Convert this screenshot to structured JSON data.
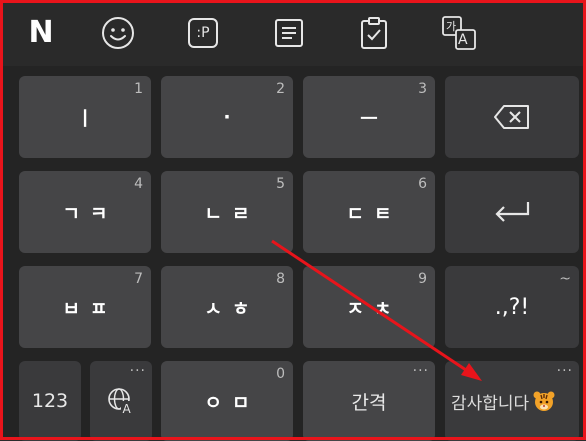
{
  "toolbar": {
    "items": [
      {
        "name": "naver-logo",
        "text": "N"
      },
      {
        "name": "emoji-icon"
      },
      {
        "name": "emoticon-icon",
        "text": ":P"
      },
      {
        "name": "memo-icon"
      },
      {
        "name": "clipboard-icon"
      },
      {
        "name": "translate-icon",
        "text_top": "가",
        "text_bottom": "A"
      }
    ]
  },
  "keys": {
    "row1": [
      {
        "label": "ㅣ",
        "num": "1"
      },
      {
        "label": "·",
        "num": "2"
      },
      {
        "label": "ㅡ",
        "num": "3"
      },
      {
        "label": "",
        "icon": "backspace-icon"
      }
    ],
    "row2": [
      {
        "label": "ㄱㅋ",
        "num": "4"
      },
      {
        "label": "ㄴㄹ",
        "num": "5"
      },
      {
        "label": "ㄷㅌ",
        "num": "6"
      },
      {
        "label": "",
        "icon": "enter-icon"
      }
    ],
    "row3": [
      {
        "label": "ㅂㅍ",
        "num": "7"
      },
      {
        "label": "ㅅㅎ",
        "num": "8"
      },
      {
        "label": "ㅈㅊ",
        "num": "9"
      },
      {
        "label": ".,?!",
        "num": "~"
      }
    ],
    "row4": [
      {
        "label": "123"
      },
      {
        "label": "",
        "icon": "globe-language-icon",
        "dots": "···"
      },
      {
        "label": "ㅇㅁ",
        "num": "0"
      },
      {
        "label": "간격",
        "dots": "···"
      },
      {
        "label": "감사합니다",
        "dots": "···",
        "icon": "tiger-emoji-icon"
      }
    ]
  },
  "annotation": {
    "color": "#e8141b"
  }
}
